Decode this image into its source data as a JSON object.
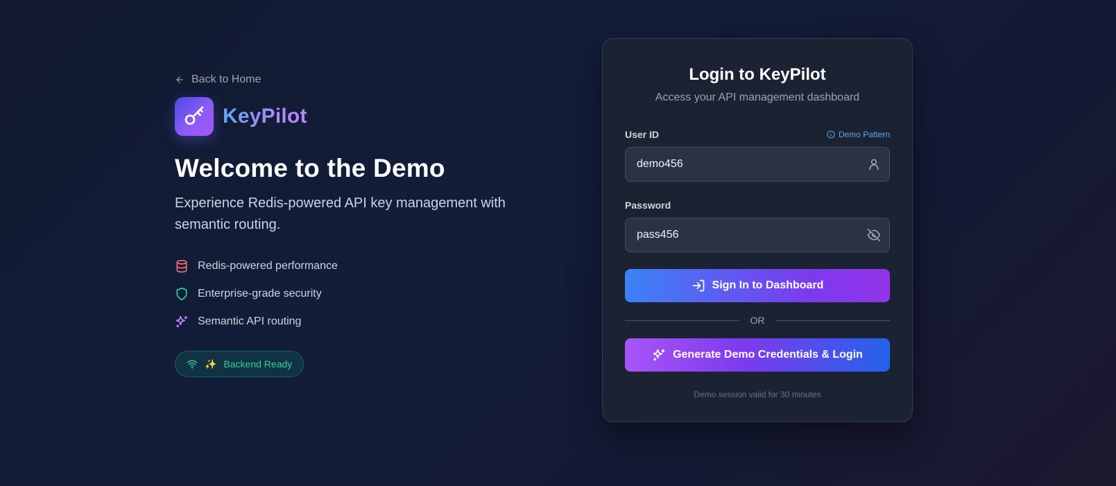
{
  "left": {
    "back_label": "Back to Home",
    "brand_name": "KeyPilot",
    "welcome_title": "Welcome to the Demo",
    "subtitle": "Experience Redis-powered API key management with semantic routing.",
    "features": [
      {
        "label": "Redis-powered performance",
        "icon": "database-icon",
        "color": "#f87171"
      },
      {
        "label": "Enterprise-grade security",
        "icon": "shield-icon",
        "color": "#34d399"
      },
      {
        "label": "Semantic API routing",
        "icon": "sparkles-icon",
        "color": "#c084fc"
      }
    ],
    "status_badge": "Backend Ready",
    "status_emoji": "✨"
  },
  "card": {
    "title": "Login to KeyPilot",
    "subtitle": "Access your API management dashboard",
    "user_id_label": "User ID",
    "demo_pattern_label": "Demo Pattern",
    "user_id_value": "demo456",
    "password_label": "Password",
    "password_value": "pass456",
    "signin_label": "Sign In to Dashboard",
    "divider_label": "OR",
    "demo_button_label": "Generate Demo Credentials & Login",
    "footnote": "Demo session valid for 30 minutes"
  },
  "colors": {
    "background": "#121a33",
    "card": "#1b2332",
    "accent_blue": "#3b82f6",
    "accent_purple": "#9333ea",
    "success": "#34d399"
  }
}
